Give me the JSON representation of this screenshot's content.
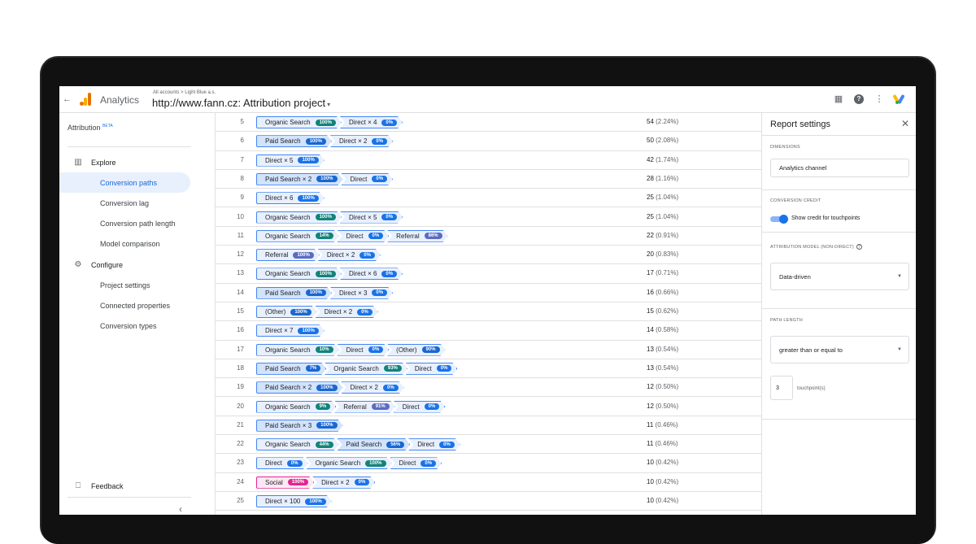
{
  "topbar": {
    "app_name": "Analytics",
    "breadcrumb": "All accounts > Light Blue a.s.",
    "property_title": "http://www.fann.cz: Attribution project",
    "caret": "▾"
  },
  "sidebar": {
    "title": "Attribution",
    "beta": "BETA",
    "explore": "Explore",
    "items_explore": [
      "Conversion paths",
      "Conversion lag",
      "Conversion path length",
      "Model comparison"
    ],
    "configure": "Configure",
    "items_configure": [
      "Project settings",
      "Connected properties",
      "Conversion types"
    ],
    "feedback": "Feedback",
    "active_item": "Conversion paths"
  },
  "rows": [
    {
      "num": "5",
      "chips": [
        {
          "label": "Organic Search",
          "pct": "100%",
          "kind": "organic"
        },
        {
          "label": "Direct × 4",
          "pct": "0%",
          "kind": "direct"
        }
      ],
      "conv": "54",
      "share": "(2.24%)"
    },
    {
      "num": "6",
      "chips": [
        {
          "label": "Paid Search",
          "pct": "100%",
          "kind": "paid"
        },
        {
          "label": "Direct × 2",
          "pct": "0%",
          "kind": "direct"
        }
      ],
      "conv": "50",
      "share": "(2.08%)"
    },
    {
      "num": "7",
      "chips": [
        {
          "label": "Direct × 5",
          "pct": "100%",
          "kind": "direct"
        }
      ],
      "conv": "42",
      "share": "(1.74%)"
    },
    {
      "num": "8",
      "chips": [
        {
          "label": "Paid Search × 2",
          "pct": "100%",
          "kind": "paid"
        },
        {
          "label": "Direct",
          "pct": "0%",
          "kind": "direct"
        }
      ],
      "conv": "28",
      "share": "(1.16%)"
    },
    {
      "num": "9",
      "chips": [
        {
          "label": "Direct × 6",
          "pct": "100%",
          "kind": "direct"
        }
      ],
      "conv": "25",
      "share": "(1.04%)"
    },
    {
      "num": "10",
      "chips": [
        {
          "label": "Organic Search",
          "pct": "100%",
          "kind": "organic"
        },
        {
          "label": "Direct × 5",
          "pct": "0%",
          "kind": "direct"
        }
      ],
      "conv": "25",
      "share": "(1.04%)"
    },
    {
      "num": "11",
      "chips": [
        {
          "label": "Organic Search",
          "pct": "14%",
          "kind": "organic"
        },
        {
          "label": "Direct",
          "pct": "0%",
          "kind": "direct"
        },
        {
          "label": "Referral",
          "pct": "86%",
          "kind": "referral"
        }
      ],
      "conv": "22",
      "share": "(0.91%)"
    },
    {
      "num": "12",
      "chips": [
        {
          "label": "Referral",
          "pct": "100%",
          "kind": "referral"
        },
        {
          "label": "Direct × 2",
          "pct": "0%",
          "kind": "direct"
        }
      ],
      "conv": "20",
      "share": "(0.83%)"
    },
    {
      "num": "13",
      "chips": [
        {
          "label": "Organic Search",
          "pct": "100%",
          "kind": "organic"
        },
        {
          "label": "Direct × 6",
          "pct": "0%",
          "kind": "direct"
        }
      ],
      "conv": "17",
      "share": "(0.71%)"
    },
    {
      "num": "14",
      "chips": [
        {
          "label": "Paid Search",
          "pct": "100%",
          "kind": "paid"
        },
        {
          "label": "Direct × 3",
          "pct": "0%",
          "kind": "direct"
        }
      ],
      "conv": "16",
      "share": "(0.66%)"
    },
    {
      "num": "15",
      "chips": [
        {
          "label": "(Other)",
          "pct": "100%",
          "kind": "other"
        },
        {
          "label": "Direct × 2",
          "pct": "0%",
          "kind": "direct"
        }
      ],
      "conv": "15",
      "share": "(0.62%)"
    },
    {
      "num": "16",
      "chips": [
        {
          "label": "Direct × 7",
          "pct": "100%",
          "kind": "direct"
        }
      ],
      "conv": "14",
      "share": "(0.58%)"
    },
    {
      "num": "17",
      "chips": [
        {
          "label": "Organic Search",
          "pct": "10%",
          "kind": "organic"
        },
        {
          "label": "Direct",
          "pct": "0%",
          "kind": "direct"
        },
        {
          "label": "(Other)",
          "pct": "90%",
          "kind": "other"
        }
      ],
      "conv": "13",
      "share": "(0.54%)"
    },
    {
      "num": "18",
      "chips": [
        {
          "label": "Paid Search",
          "pct": "7%",
          "kind": "paid"
        },
        {
          "label": "Organic Search",
          "pct": "93%",
          "kind": "organic"
        },
        {
          "label": "Direct",
          "pct": "0%",
          "kind": "direct"
        }
      ],
      "conv": "13",
      "share": "(0.54%)"
    },
    {
      "num": "19",
      "chips": [
        {
          "label": "Paid Search × 2",
          "pct": "100%",
          "kind": "paid"
        },
        {
          "label": "Direct × 2",
          "pct": "0%",
          "kind": "direct"
        }
      ],
      "conv": "12",
      "share": "(0.50%)"
    },
    {
      "num": "20",
      "chips": [
        {
          "label": "Organic Search",
          "pct": "9%",
          "kind": "organic"
        },
        {
          "label": "Referral",
          "pct": "91%",
          "kind": "referral"
        },
        {
          "label": "Direct",
          "pct": "0%",
          "kind": "direct"
        }
      ],
      "conv": "12",
      "share": "(0.50%)"
    },
    {
      "num": "21",
      "chips": [
        {
          "label": "Paid Search × 3",
          "pct": "100%",
          "kind": "paid"
        }
      ],
      "conv": "11",
      "share": "(0.46%)"
    },
    {
      "num": "22",
      "chips": [
        {
          "label": "Organic Search",
          "pct": "44%",
          "kind": "organic"
        },
        {
          "label": "Paid Search",
          "pct": "56%",
          "kind": "paid"
        },
        {
          "label": "Direct",
          "pct": "0%",
          "kind": "direct"
        }
      ],
      "conv": "11",
      "share": "(0.46%)"
    },
    {
      "num": "23",
      "chips": [
        {
          "label": "Direct",
          "pct": "0%",
          "kind": "direct"
        },
        {
          "label": "Organic Search",
          "pct": "100%",
          "kind": "organic"
        },
        {
          "label": "Direct",
          "pct": "0%",
          "kind": "direct"
        }
      ],
      "conv": "10",
      "share": "(0.42%)"
    },
    {
      "num": "24",
      "chips": [
        {
          "label": "Social",
          "pct": "100%",
          "kind": "social"
        },
        {
          "label": "Direct × 2",
          "pct": "0%",
          "kind": "direct"
        }
      ],
      "conv": "10",
      "share": "(0.42%)"
    },
    {
      "num": "25",
      "chips": [
        {
          "label": "Direct × 100",
          "pct": "100%",
          "kind": "direct"
        }
      ],
      "conv": "10",
      "share": "(0.42%)"
    }
  ],
  "settings": {
    "title": "Report settings",
    "close": "✕",
    "dimensions_label": "DIMENSIONS",
    "dimensions_value": "Analytics channel",
    "credit_label": "CONVERSION CREDIT",
    "toggle_label": "Show credit for touchpoints",
    "toggle_on": true,
    "model_label": "ATTRIBUTION MODEL (NON-DIRECT)",
    "model_value": "Data-driven",
    "path_label": "PATH LENGTH",
    "path_value": "greater than or equal to",
    "touchpoints_value": "3",
    "touchpoints_label": "touchpoint(s)"
  },
  "colors": {
    "chip_border": "#4285f4",
    "chip_bg": "#e8f0fe",
    "organic": "#12837a",
    "paid": "#1967d2",
    "referral": "#5c6bc0",
    "social": "#e52592",
    "active_nav": "#e8f0fe"
  }
}
